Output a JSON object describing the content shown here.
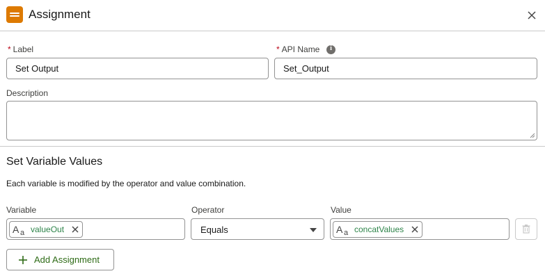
{
  "header": {
    "title": "Assignment"
  },
  "form": {
    "label_label": "Label",
    "label_value": "Set Output",
    "api_name_label": "API Name",
    "api_name_value": "Set_Output",
    "required_mark": "*",
    "description_label": "Description",
    "description_value": ""
  },
  "section": {
    "title": "Set Variable Values",
    "description": "Each variable is modified by the operator and value combination."
  },
  "assignment": {
    "variable_label": "Variable",
    "operator_label": "Operator",
    "value_label": "Value",
    "variable_value": "valueOut",
    "operator_value": "Equals",
    "value_value": "concatValues"
  },
  "actions": {
    "add_label": "Add Assignment"
  },
  "colors": {
    "accent": "#dd7a01",
    "required": "#ba0517",
    "pill_text": "#2e844a"
  }
}
